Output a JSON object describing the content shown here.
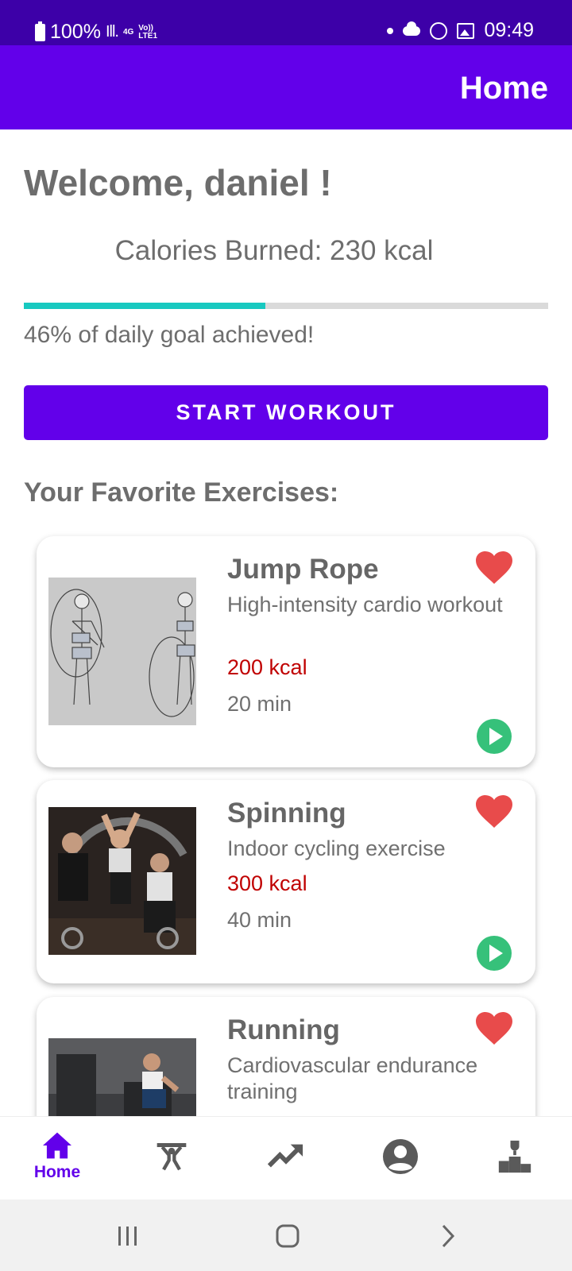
{
  "status_bar": {
    "battery": "100%",
    "network": "4G",
    "volte": "Vo)) LTE1",
    "time": "09:49"
  },
  "app_bar": {
    "title": "Home"
  },
  "welcome": "Welcome, daniel !",
  "calories_text": "Calories Burned: 230 kcal",
  "progress": {
    "fraction": 0.46,
    "color": "#18c9c0",
    "track_color": "#dadada"
  },
  "goal_text": "46% of daily goal achieved!",
  "start_button": "START WORKOUT",
  "favorites_title": "Your Favorite Exercises:",
  "exercises": [
    {
      "name": "Jump Rope",
      "description": "High-intensity cardio workout",
      "kcal": "200 kcal",
      "duration": "20 min",
      "favorite_icon": "heart-icon",
      "play_icon": "play-icon"
    },
    {
      "name": "Spinning",
      "description": "Indoor cycling exercise",
      "kcal": "300 kcal",
      "duration": "40 min",
      "favorite_icon": "heart-icon",
      "play_icon": "play-icon"
    },
    {
      "name": "Running",
      "description": "Cardiovascular endurance training",
      "favorite_icon": "heart-icon"
    }
  ],
  "bottom_nav": [
    {
      "label": "Home",
      "icon": "home-icon",
      "active": true
    },
    {
      "icon": "weightlifting-icon"
    },
    {
      "icon": "trending-up-icon"
    },
    {
      "icon": "account-circle-icon"
    },
    {
      "icon": "podium-trophy-icon"
    }
  ],
  "colors": {
    "primary": "#6200ea",
    "status_bar": "#3d00a8",
    "kcal": "#c00000",
    "heart": "#e84b4b",
    "play": "#36c17a"
  }
}
